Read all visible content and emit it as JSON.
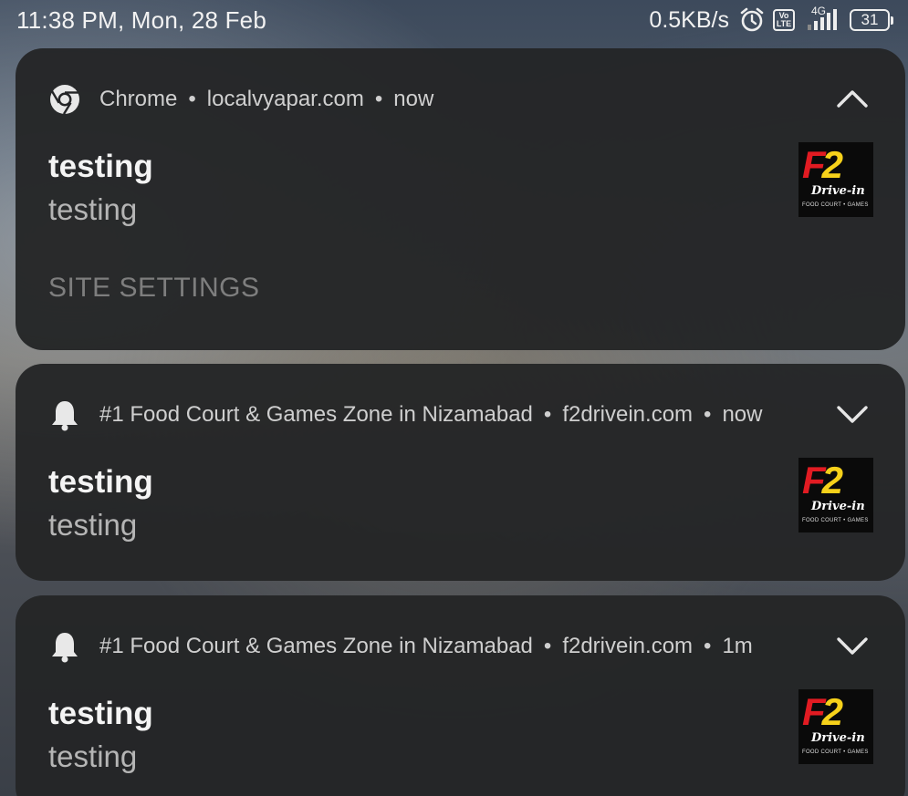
{
  "status_bar": {
    "time": "11:38 PM, Mon, 28 Feb",
    "speed": "0.5KB/s",
    "network_type": "4G",
    "volte_top": "Vo",
    "volte_bottom": "LTE",
    "battery": "31",
    "icons": [
      "alarm-icon",
      "volte-icon",
      "signal-icon",
      "battery-icon"
    ]
  },
  "notifications": [
    {
      "app_icon": "chrome-icon",
      "app": "Chrome",
      "source": "localvyapar.com",
      "time": "now",
      "expanded": true,
      "title": "testing",
      "body": "testing",
      "action": "SITE SETTINGS",
      "thumb": {
        "big": "F2",
        "brand": "Drive-in",
        "tagline": "FOOD COURT • GAMES"
      }
    },
    {
      "app_icon": "bell-icon",
      "app": "#1 Food Court & Games Zone in Nizamabad",
      "source": "f2drivein.com",
      "time": "now",
      "expanded": false,
      "title": "testing",
      "body": "testing",
      "thumb": {
        "big": "F2",
        "brand": "Drive-in",
        "tagline": "FOOD COURT • GAMES"
      }
    },
    {
      "app_icon": "bell-icon",
      "app": "#1 Food Court & Games Zone in Nizamabad",
      "source": "f2drivein.com",
      "time": "1m",
      "expanded": false,
      "title": "testing",
      "body": "testing",
      "thumb": {
        "big": "F2",
        "brand": "Drive-in",
        "tagline": "FOOD COURT • GAMES"
      }
    }
  ],
  "colors": {
    "card_bg": "#242527",
    "title": "#f4f4f4",
    "body": "#b5b5b5",
    "action": "#7e7e7e",
    "logo_red": "#e11b22",
    "logo_yellow": "#f6d11a"
  }
}
